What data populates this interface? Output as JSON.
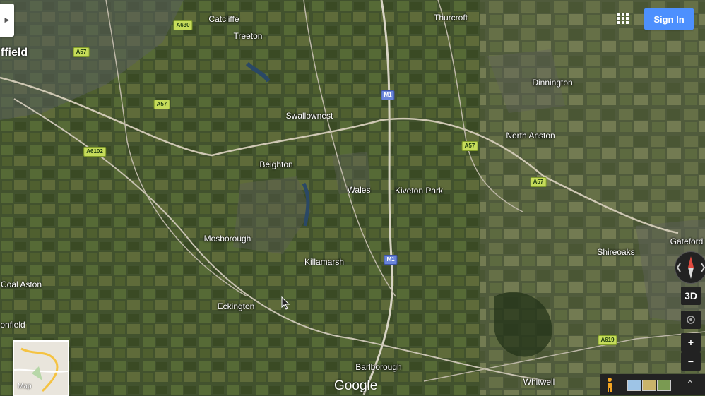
{
  "places": [
    {
      "name": "Catcliffe",
      "size": "normal"
    },
    {
      "name": "Treeton",
      "size": "normal"
    },
    {
      "name": "Thurcroft",
      "size": "normal"
    },
    {
      "name": "ffield",
      "size": "big"
    },
    {
      "name": "Dinnington",
      "size": "normal"
    },
    {
      "name": "Swallownest",
      "size": "normal"
    },
    {
      "name": "North Anston",
      "size": "normal"
    },
    {
      "name": "Beighton",
      "size": "normal"
    },
    {
      "name": "Wales",
      "size": "normal"
    },
    {
      "name": "Kiveton Park",
      "size": "normal"
    },
    {
      "name": "Mosborough",
      "size": "normal"
    },
    {
      "name": "Killamarsh",
      "size": "normal"
    },
    {
      "name": "Shireoaks",
      "size": "normal"
    },
    {
      "name": "Gateford",
      "size": "normal"
    },
    {
      "name": "Coal Aston",
      "size": "normal"
    },
    {
      "name": "Eckington",
      "size": "normal"
    },
    {
      "name": "onfield",
      "size": "normal"
    },
    {
      "name": "Barlborough",
      "size": "normal"
    },
    {
      "name": "Whitwell",
      "size": "normal"
    }
  ],
  "road_shields": [
    {
      "label": "A630",
      "type": "a"
    },
    {
      "label": "A57",
      "type": "a"
    },
    {
      "label": "A57",
      "type": "a"
    },
    {
      "label": "A6102",
      "type": "a"
    },
    {
      "label": "M1",
      "type": "m"
    },
    {
      "label": "A57",
      "type": "a"
    },
    {
      "label": "A57",
      "type": "a"
    },
    {
      "label": "M1",
      "type": "m"
    },
    {
      "label": "A619",
      "type": "a"
    }
  ],
  "controls": {
    "signin_label": "Sign In",
    "view_3d_label": "3D",
    "zoom_in_label": "+",
    "zoom_out_label": "−",
    "minimap_label": "Map",
    "expand_glyph": "⌃",
    "toggle_glyph": "▶"
  },
  "attribution": "Google",
  "colors": {
    "signin": "#4d90fe",
    "terrain": "#3b4a2c"
  }
}
